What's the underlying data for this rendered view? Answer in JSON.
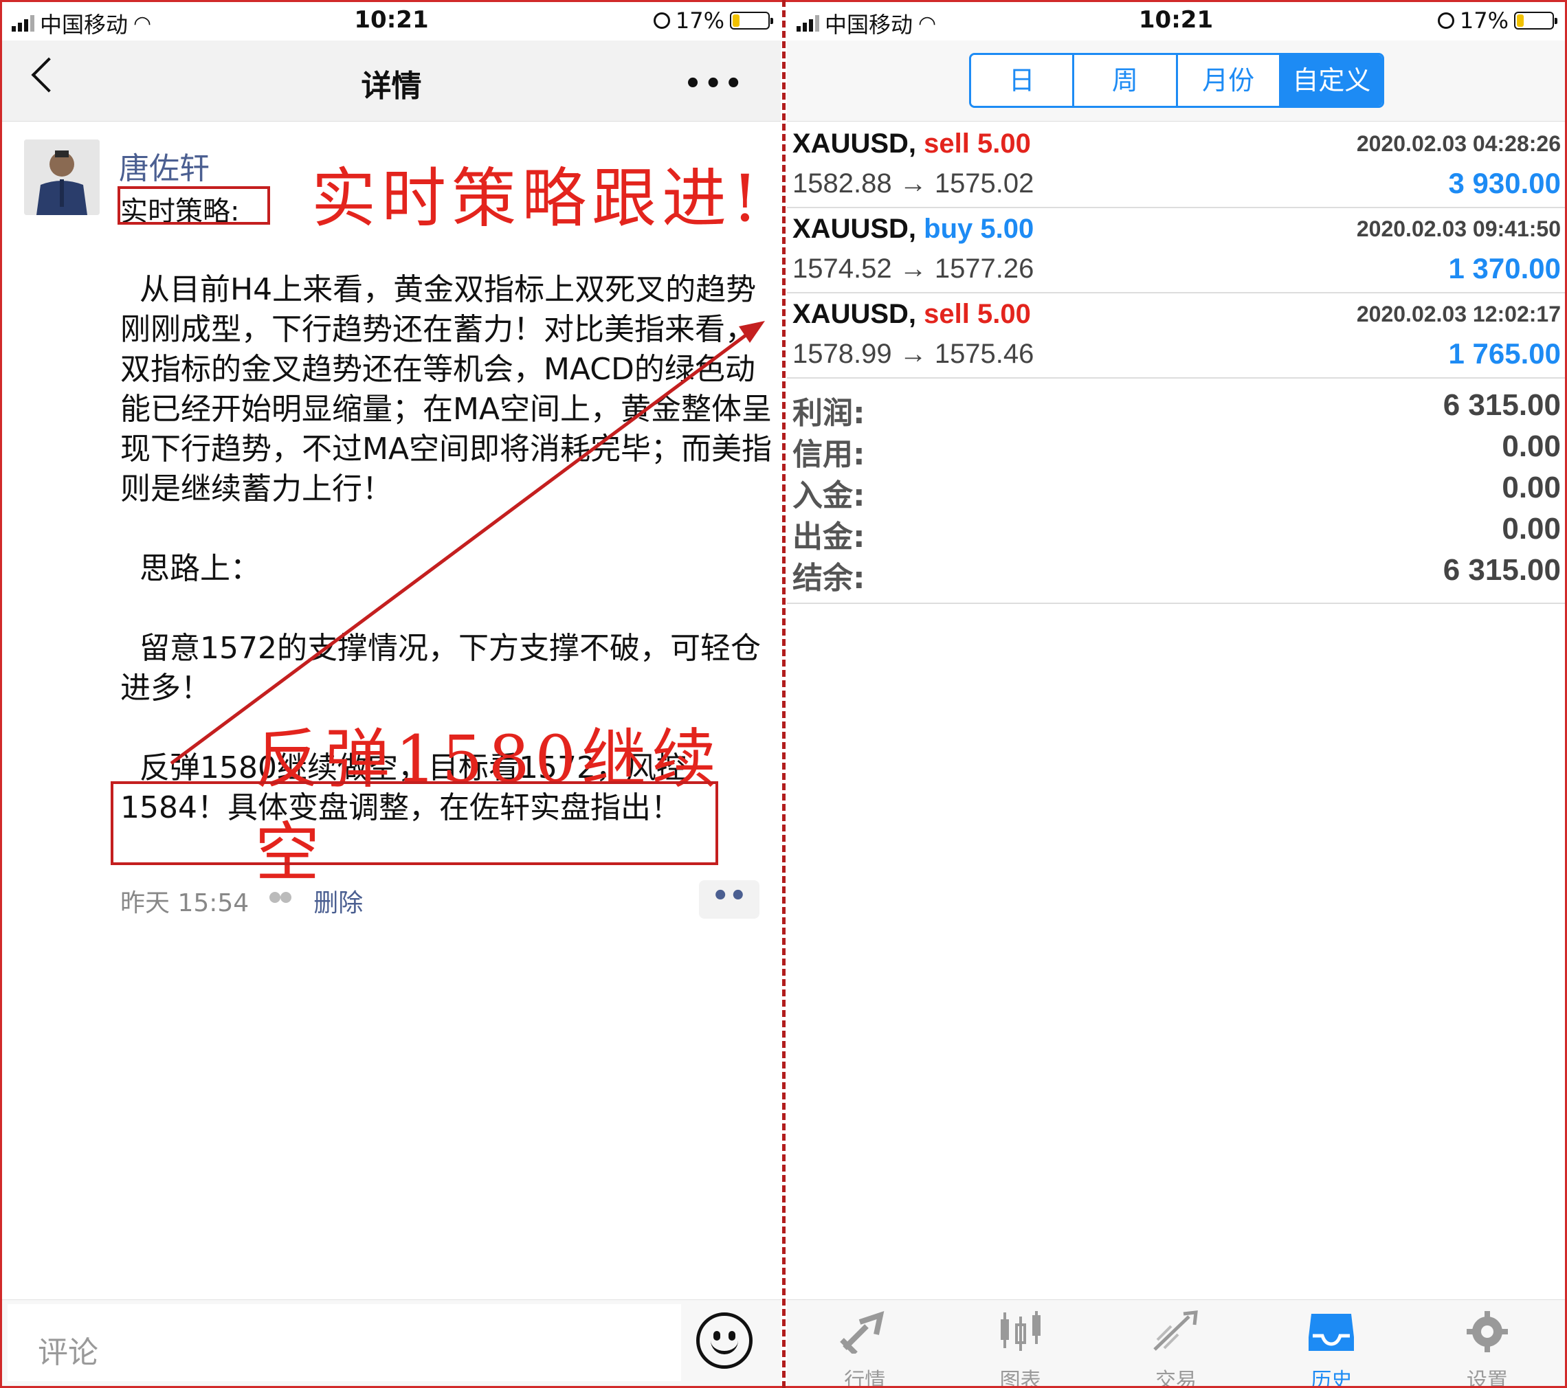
{
  "left": {
    "status": {
      "carrier": "中国移动",
      "time": "10:21",
      "battery": "17%"
    },
    "nav": {
      "title": "详情",
      "more": "•••"
    },
    "author": "唐佐轩",
    "label_strategy": "实时策略:",
    "annotation_top": "实时策略跟进!",
    "annotation_mid": "反弹1580继续空",
    "paragraphs": [
      "  从目前H4上来看，黄金双指标上双死叉的趋势刚刚成型，下行趋势还在蓄力！对比美指来看，双指标的金叉趋势还在等机会，MACD的绿色动能已经开始明显缩量；在MA空间上，黄金整体呈现下行趋势，不过MA空间即将消耗完毕；而美指则是继续蓄力上行！",
      "  思路上：",
      "  留意1572的支撑情况，下方支撑不破，可轻仓进多！",
      "  反弹1580继续做空，目标看1572，风控1584！具体变盘调整，在佐轩实盘指出！"
    ],
    "meta": {
      "time": "昨天 15:54",
      "delete": "删除"
    },
    "more_dots": "••",
    "comment_placeholder": "评论"
  },
  "right": {
    "status": {
      "carrier": "中国移动",
      "time": "10:21",
      "battery": "17%"
    },
    "segments": [
      "日",
      "周",
      "月份",
      "自定义"
    ],
    "active_segment": "自定义",
    "trades": [
      {
        "symbol": "XAUUSD,",
        "side": "sell",
        "lots": "5.00",
        "date": "2020.02.03 04:28:26",
        "prices": "1582.88 → 1575.02",
        "profit": "3 930.00"
      },
      {
        "symbol": "XAUUSD,",
        "side": "buy",
        "lots": "5.00",
        "date": "2020.02.03 09:41:50",
        "prices": "1574.52 → 1577.26",
        "profit": "1 370.00"
      },
      {
        "symbol": "XAUUSD,",
        "side": "sell",
        "lots": "5.00",
        "date": "2020.02.03 12:02:17",
        "prices": "1578.99 → 1575.46",
        "profit": "1 765.00"
      }
    ],
    "summary": [
      {
        "key": "利润:",
        "value": "6 315.00"
      },
      {
        "key": "信用:",
        "value": "0.00"
      },
      {
        "key": "入金:",
        "value": "0.00"
      },
      {
        "key": "出金:",
        "value": "0.00"
      },
      {
        "key": "结余:",
        "value": "6 315.00"
      }
    ],
    "tabs": [
      {
        "label": "行情",
        "icon": "quotes-icon"
      },
      {
        "label": "图表",
        "icon": "chart-icon"
      },
      {
        "label": "交易",
        "icon": "trade-icon"
      },
      {
        "label": "历史",
        "icon": "history-icon"
      },
      {
        "label": "设置",
        "icon": "settings-icon"
      }
    ],
    "active_tab": "历史"
  },
  "colors": {
    "annotation_red": "#e3241d",
    "accent_blue": "#1d8bf4",
    "sell_red": "#e3241d",
    "username_blue": "#4b5f91"
  }
}
